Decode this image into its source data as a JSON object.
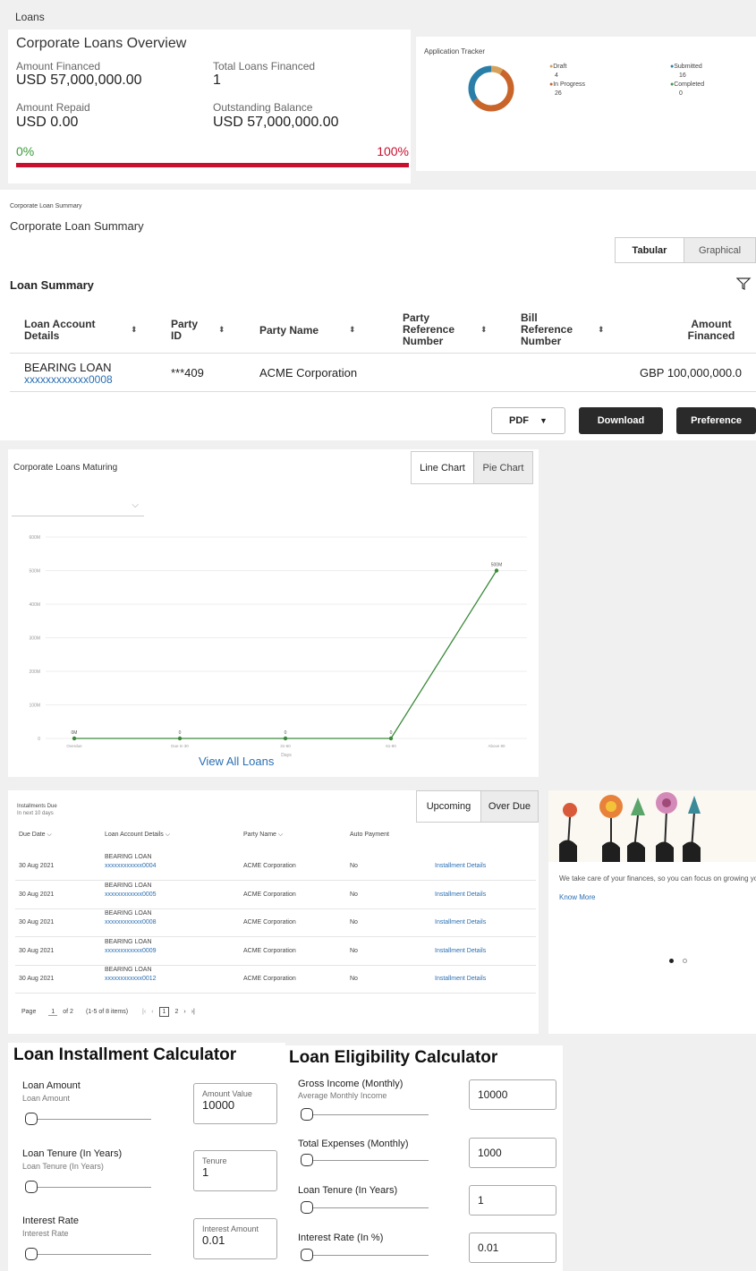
{
  "page": {
    "title": "Loans"
  },
  "overview": {
    "title": "Corporate Loans Overview",
    "amount_financed_label": "Amount Financed",
    "amount_financed": "USD 57,000,000.00",
    "total_loans_label": "Total Loans Financed",
    "total_loans": "1",
    "amount_repaid_label": "Amount Repaid",
    "amount_repaid": "USD 0.00",
    "outstanding_label": "Outstanding Balance",
    "outstanding": "USD 57,000,000.00",
    "progress_left": "0%",
    "progress_right": "100%",
    "progress_fraction": 1.0,
    "accent": "#c8102e"
  },
  "tracker": {
    "title": "Application Tracker",
    "items": [
      {
        "label": "Draft",
        "value": "4",
        "color": "#d6a15a"
      },
      {
        "label": "In Progress",
        "value": "26",
        "color": "#c9652a"
      },
      {
        "label": "Submitted",
        "value": "16",
        "color": "#2a7fa8"
      },
      {
        "label": "Completed",
        "value": "0",
        "color": "#3a9a4a"
      }
    ]
  },
  "summary": {
    "breadcrumb": "Corporate Loan Summary",
    "title": "Corporate Loan Summary",
    "view_tabs": [
      "Tabular",
      "Graphical"
    ],
    "section_title": "Loan Summary",
    "columns": [
      "Loan Account Details",
      "Party ID",
      "Party Name",
      "Party Reference Number",
      "Bill Reference Number",
      "Amount Financed"
    ],
    "row": {
      "loan_name": "BEARING LOAN",
      "account": "xxxxxxxxxxxx0008",
      "party_id": "***409",
      "party_name": "ACME Corporation",
      "amount": "GBP 100,000,000.0"
    },
    "format": "PDF",
    "download_label": "Download",
    "preference_label": "Preference"
  },
  "maturing": {
    "title": "Corporate Loans Maturing",
    "tabs": [
      "Line Chart",
      "Pie Chart"
    ],
    "view_all": "View All Loans"
  },
  "chart_data": {
    "type": "line",
    "categories": [
      "Overdue",
      "Due In 30",
      "31-60",
      "61-90",
      "Above 90"
    ],
    "values": [
      0,
      0,
      0,
      0,
      500
    ],
    "point_labels": [
      "0M",
      "0",
      "0",
      "0",
      "500M"
    ],
    "y_ticks": [
      "0",
      "100M",
      "200M",
      "300M",
      "400M",
      "500M",
      "600M"
    ],
    "ylim": [
      0,
      600
    ],
    "xlabel": "Days",
    "color": "#3a8a3a"
  },
  "installments": {
    "title": "Installments Due",
    "subtitle": "In next 10 days",
    "tabs": [
      "Upcoming",
      "Over Due"
    ],
    "columns": [
      "Due Date",
      "Loan Account Details",
      "Party Name",
      "Auto Payment"
    ],
    "rows": [
      {
        "date": "30 Aug 2021",
        "loan": "BEARING LOAN",
        "account": "xxxxxxxxxxxx0004",
        "party": "ACME Corporation",
        "auto": "No",
        "link": "Installment Details"
      },
      {
        "date": "30 Aug 2021",
        "loan": "BEARING LOAN",
        "account": "xxxxxxxxxxxx0005",
        "party": "ACME Corporation",
        "auto": "No",
        "link": "Installment Details"
      },
      {
        "date": "30 Aug 2021",
        "loan": "BEARING LOAN",
        "account": "xxxxxxxxxxxx0008",
        "party": "ACME Corporation",
        "auto": "No",
        "link": "Installment Details"
      },
      {
        "date": "30 Aug 2021",
        "loan": "BEARING LOAN",
        "account": "xxxxxxxxxxxx0009",
        "party": "ACME Corporation",
        "auto": "No",
        "link": "Installment Details"
      },
      {
        "date": "30 Aug 2021",
        "loan": "BEARING LOAN",
        "account": "xxxxxxxxxxxx0012",
        "party": "ACME Corporation",
        "auto": "No",
        "link": "Installment Details"
      }
    ],
    "pager": {
      "page_label": "Page",
      "page": "1",
      "of": "of 2",
      "items": "(1-5 of 8 items)",
      "pages": [
        "1",
        "2"
      ]
    }
  },
  "promo": {
    "text": "We take care of your finances, so you can focus on growing your b",
    "link": "Know More"
  },
  "installment_calc": {
    "title": "Loan Installment Calculator",
    "fields": [
      {
        "label": "Loan Amount",
        "sub": "Loan Amount",
        "box_label": "Amount Value",
        "value": "10000"
      },
      {
        "label": "Loan Tenure (In Years)",
        "sub": "Loan Tenure (In Years)",
        "box_label": "Tenure",
        "value": "1"
      },
      {
        "label": "Interest Rate",
        "sub": "Interest Rate",
        "box_label": "Interest Amount",
        "value": "0.01"
      }
    ]
  },
  "eligibility_calc": {
    "title": "Loan Eligibility Calculator",
    "fields": [
      {
        "label": "Gross Income (Monthly)",
        "sub": "Average Monthly Income",
        "value": "10000"
      },
      {
        "label": "Total Expenses (Monthly)",
        "value": "1000"
      },
      {
        "label": "Loan Tenure (In Years)",
        "value": "1"
      },
      {
        "label": "Interest Rate (In %)",
        "value": "0.01"
      }
    ]
  }
}
